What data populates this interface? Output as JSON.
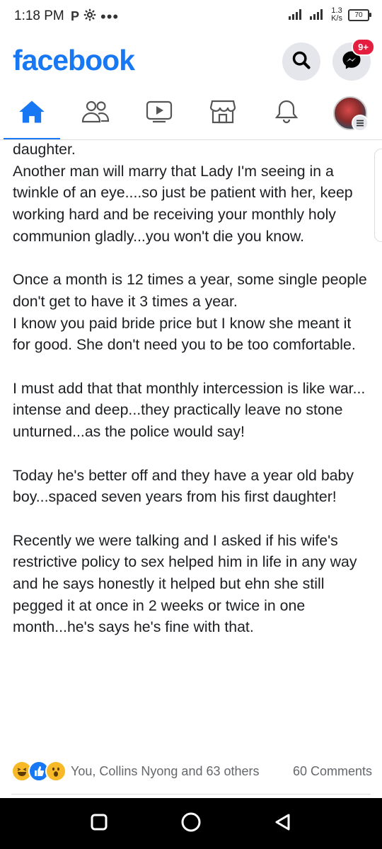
{
  "status_bar": {
    "time": "1:18 PM",
    "speed_value": "1.3",
    "speed_unit": "K/s",
    "battery": "70",
    "icons": [
      "p-icon",
      "gear-icon",
      "more-dots-icon",
      "signal-icon",
      "wifi-signal-icon",
      "battery-icon"
    ]
  },
  "header": {
    "logo": "facebook",
    "messenger_badge": "9+"
  },
  "tabs": [
    {
      "name": "home",
      "active": true
    },
    {
      "name": "friends"
    },
    {
      "name": "watch"
    },
    {
      "name": "marketplace"
    },
    {
      "name": "notifications"
    },
    {
      "name": "menu"
    }
  ],
  "post": {
    "paragraphs": [
      "daughter.\nAnother man will marry that Lady I'm seeing in a twinkle of an eye....so just be patient with her, keep working hard and be receiving your monthly holy communion gladly...you won't die you know.",
      "Once a month is 12 times a year, some single people don't get to have it 3 times a year.\nI know you paid bride price but I know she meant it for good. She don't need you to be too comfortable.",
      "I must add that that monthly intercession is like war... intense and deep...they practically leave no stone unturned...as the police would say!",
      "Today he's better off and they have a year old baby boy...spaced seven years from his first daughter!",
      "Recently we were talking and I asked if his wife's restrictive policy to sex helped him in life in any way and he says honestly it helped but ehn she still pegged it at once in 2 weeks or twice in one month...he's says he's fine with that."
    ],
    "reactions_text": "You, Collins Nyong and 63 others",
    "comments_text": "60 Comments",
    "reaction_types": [
      "haha",
      "like",
      "wow"
    ]
  },
  "colors": {
    "brand": "#1877f2",
    "badge": "#e41e3f",
    "text": "#1c1e21",
    "muted": "#65676b"
  }
}
